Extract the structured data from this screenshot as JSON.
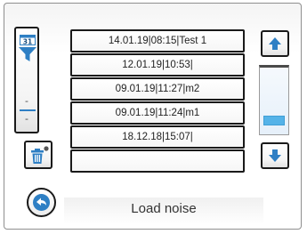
{
  "filter": {
    "calendar_day": "31",
    "upper_value": "-",
    "lower_value": "-"
  },
  "files": [
    {
      "label": "14.01.19|08:15|Test 1"
    },
    {
      "label": "12.01.19|10:53|"
    },
    {
      "label": "09.01.19|11:27|m2"
    },
    {
      "label": "09.01.19|11:24|m1"
    },
    {
      "label": "18.12.18|15:07|"
    },
    {
      "label": ""
    }
  ],
  "scroll": {
    "thumb_position_fraction": 0.85
  },
  "status": {
    "title": "Load noise"
  },
  "icons": {
    "filter": "filter-icon",
    "calendar": "calendar-icon",
    "delete": "trash-icon",
    "up": "arrow-up-icon",
    "down": "arrow-down-icon",
    "back": "back-arrow-icon"
  },
  "colors": {
    "accent": "#2e7fc4",
    "scroll_thumb": "#55b3e8",
    "scroll_track": "#e6f0fa",
    "border": "#1a1a1a"
  }
}
